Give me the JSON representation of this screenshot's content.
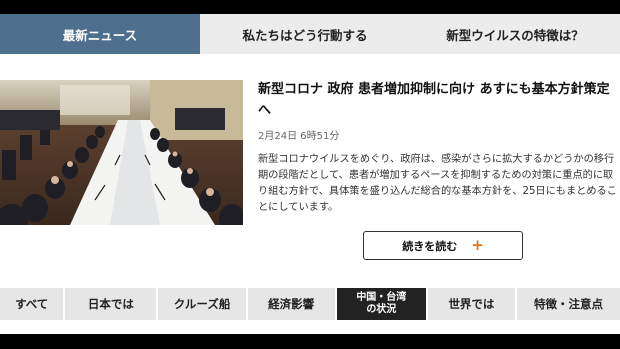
{
  "tabs": [
    {
      "label": "最新ニュース",
      "active": true
    },
    {
      "label": "私たちはどう行動する",
      "active": false
    },
    {
      "label": "新型ウイルスの特徴は？",
      "active": false
    }
  ],
  "article": {
    "title": "新型コロナ 政府 患者増加抑制に向け あすにも基本方針策定へ",
    "time": "2月24日 6時51分",
    "body": "新型コロナウイルスをめぐり、政府は、感染がさらに拡大するかどうかの移行期の段階だとして、患者が増加するペースを抑制するための対策に重点的に取り組む方針で、具体策を盛り込んだ総合的な基本方針を、25日にもまとめることにしています。",
    "more_label": "続きを読む",
    "more_icon": "+"
  },
  "categories": [
    {
      "label": "すべて",
      "active": false
    },
    {
      "label": "日本では",
      "active": false
    },
    {
      "label": "クルーズ船",
      "active": false
    },
    {
      "label": "経済影響",
      "active": false
    },
    {
      "label": "中国・台湾の状況",
      "line1": "中国・台湾",
      "line2": "の状況",
      "active": true
    },
    {
      "label": "世界では",
      "active": false
    },
    {
      "label": "特徴・注意点",
      "active": false
    }
  ],
  "colors": {
    "active_tab": "#4f6f8f",
    "active_category": "#222222",
    "accent_plus": "#e0711c"
  }
}
